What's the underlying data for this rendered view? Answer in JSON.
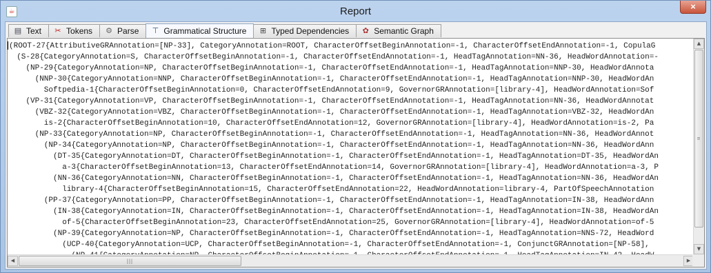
{
  "window": {
    "title": "Report",
    "close_label": "×"
  },
  "tabs": [
    {
      "label": "Text",
      "icon": "text-doc-icon"
    },
    {
      "label": "Tokens",
      "icon": "scissors-icon"
    },
    {
      "label": "Parse",
      "icon": "gears-icon"
    },
    {
      "label": "Grammatical Structure",
      "icon": "tree-icon"
    },
    {
      "label": "Typed Dependencies",
      "icon": "dependency-icon"
    },
    {
      "label": "Semantic Graph",
      "icon": "graph-icon"
    }
  ],
  "active_tab": "Grammatical Structure",
  "lines": [
    "(ROOT-27{AttributiveGRAnnotation=[NP-33], CategoryAnnotation=ROOT, CharacterOffsetBeginAnnotation=-1, CharacterOffsetEndAnnotation=-1, CopulaG",
    "  (S-28{CategoryAnnotation=S, CharacterOffsetBeginAnnotation=-1, CharacterOffsetEndAnnotation=-1, HeadTagAnnotation=NN-36, HeadWordAnnotation=-",
    "    (NP-29{CategoryAnnotation=NP, CharacterOffsetBeginAnnotation=-1, CharacterOffsetEndAnnotation=-1, HeadTagAnnotation=NNP-30, HeadWordAnnota",
    "      (NNP-30{CategoryAnnotation=NNP, CharacterOffsetBeginAnnotation=-1, CharacterOffsetEndAnnotation=-1, HeadTagAnnotation=NNP-30, HeadWordAn",
    "        Softpedia-1{CharacterOffsetBeginAnnotation=0, CharacterOffsetEndAnnotation=9, GovernorGRAnnotation=[library-4], HeadWordAnnotation=Sof",
    "    (VP-31{CategoryAnnotation=VP, CharacterOffsetBeginAnnotation=-1, CharacterOffsetEndAnnotation=-1, HeadTagAnnotation=NN-36, HeadWordAnnotat",
    "      (VBZ-32{CategoryAnnotation=VBZ, CharacterOffsetBeginAnnotation=-1, CharacterOffsetEndAnnotation=-1, HeadTagAnnotation=VBZ-32, HeadWordAn",
    "        is-2{CharacterOffsetBeginAnnotation=10, CharacterOffsetEndAnnotation=12, GovernorGRAnnotation=[library-4], HeadWordAnnotation=is-2, Pa",
    "      (NP-33{CategoryAnnotation=NP, CharacterOffsetBeginAnnotation=-1, CharacterOffsetEndAnnotation=-1, HeadTagAnnotation=NN-36, HeadWordAnnot",
    "        (NP-34{CategoryAnnotation=NP, CharacterOffsetBeginAnnotation=-1, CharacterOffsetEndAnnotation=-1, HeadTagAnnotation=NN-36, HeadWordAnn",
    "          (DT-35{CategoryAnnotation=DT, CharacterOffsetBeginAnnotation=-1, CharacterOffsetEndAnnotation=-1, HeadTagAnnotation=DT-35, HeadWordAn",
    "            a-3{CharacterOffsetBeginAnnotation=13, CharacterOffsetEndAnnotation=14, GovernorGRAnnotation=[library-4], HeadWordAnnotation=a-3, P",
    "          (NN-36{CategoryAnnotation=NN, CharacterOffsetBeginAnnotation=-1, CharacterOffsetEndAnnotation=-1, HeadTagAnnotation=NN-36, HeadWordAn",
    "            library-4{CharacterOffsetBeginAnnotation=15, CharacterOffsetEndAnnotation=22, HeadWordAnnotation=library-4, PartOfSpeechAnnotation",
    "        (PP-37{CategoryAnnotation=PP, CharacterOffsetBeginAnnotation=-1, CharacterOffsetEndAnnotation=-1, HeadTagAnnotation=IN-38, HeadWordAnn",
    "          (IN-38{CategoryAnnotation=IN, CharacterOffsetBeginAnnotation=-1, CharacterOffsetEndAnnotation=-1, HeadTagAnnotation=IN-38, HeadWordAn",
    "            of-5{CharacterOffsetBeginAnnotation=23, CharacterOffsetEndAnnotation=25, GovernorGRAnnotation=[library-4], HeadWordAnnotation=of-5",
    "          (NP-39{CategoryAnnotation=NP, CharacterOffsetBeginAnnotation=-1, CharacterOffsetEndAnnotation=-1, HeadTagAnnotation=NNS-72, HeadWord",
    "            (UCP-40{CategoryAnnotation=UCP, CharacterOffsetBeginAnnotation=-1, CharacterOffsetEndAnnotation=-1, ConjunctGRAnnotation=[NP-58], ",
    "              (NP-41{CategoryAnnotation=NP, CharacterOffsetBeginAnnotation=-1, CharacterOffsetEndAnnotation=-1, HeadTagAnnotation=IN-42, HeadW"
  ]
}
